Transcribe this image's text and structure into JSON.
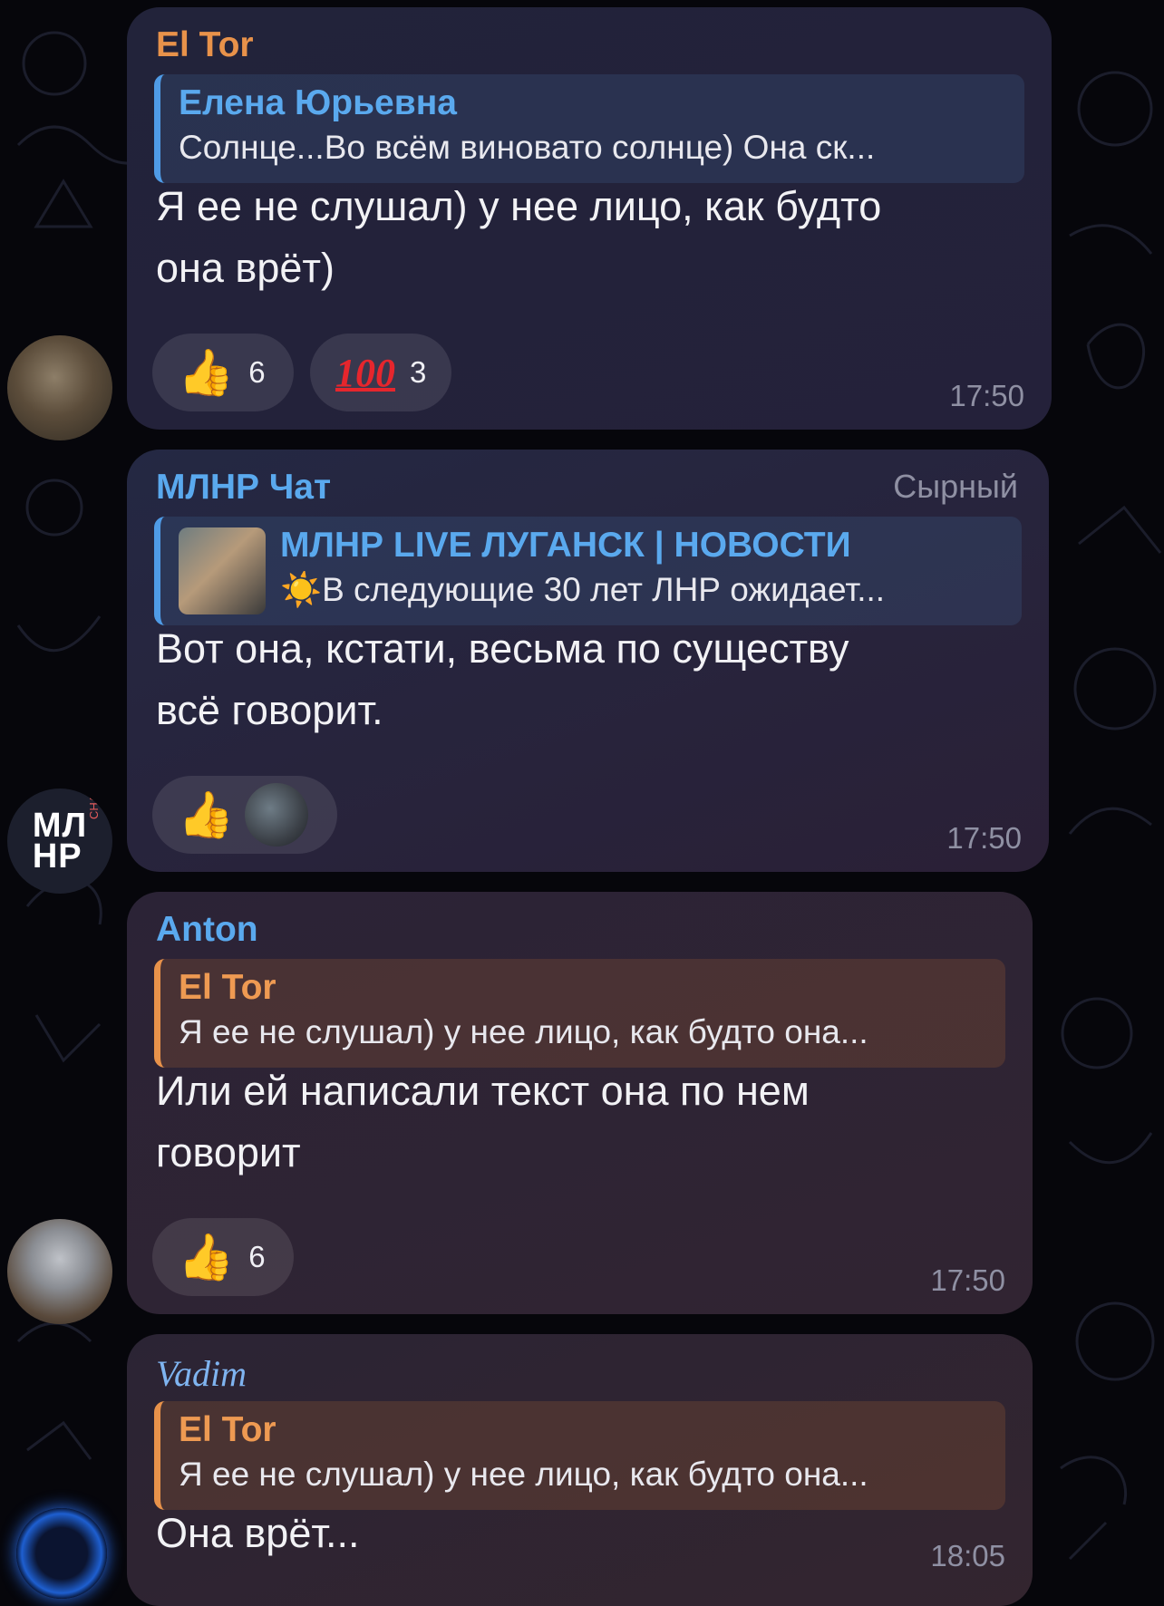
{
  "messages": [
    {
      "sender": "El Tor",
      "reply": {
        "name": "Елена Юрьевна",
        "text": "Солнце...Во всём виновато солнце) Она ск..."
      },
      "text_line1": "Я ее не слушал) у нее лицо, как будто",
      "text_line2": "она врёт)",
      "reactions": [
        {
          "emoji": "👍",
          "count": "6"
        },
        {
          "emoji": "100",
          "count": "3"
        }
      ],
      "time": "17:50",
      "avatar": "soldier-avatar"
    },
    {
      "sender": "МЛНР Чат",
      "role": "Сырный",
      "reply": {
        "name": "МЛНР LIVE ЛУГАНСК | НОВОСТИ",
        "text": "☀️В следующие 30 лет ЛНР ожидает..."
      },
      "text_line1": "Вот она, кстати, весьма по существу",
      "text_line2": "всё говорит.",
      "reactions": [
        {
          "emoji": "👍"
        }
      ],
      "time": "17:50",
      "avatar": {
        "line1": "МЛ",
        "line2": "НР",
        "tag": "CHAT"
      }
    },
    {
      "sender": "Anton",
      "reply": {
        "name": "El Tor",
        "text": "Я ее не слушал) у нее лицо, как будто она..."
      },
      "text_line1": "Или ей написали текст она по нем",
      "text_line2": "говорит",
      "reactions": [
        {
          "emoji": "👍",
          "count": "6"
        }
      ],
      "time": "17:50",
      "avatar": "kitten-avatar"
    },
    {
      "sender": "Vadim",
      "reply": {
        "name": "El Tor",
        "text": "Я ее не слушал) у нее лицо, как будто она..."
      },
      "text_line1": "Она врёт...",
      "time": "18:05",
      "avatar": "hacker-avatar"
    }
  ],
  "colors": {
    "background": "#06060b",
    "orange_name": "#e8924a",
    "blue_name": "#5aa9ee",
    "hundred_red": "#e6262d"
  }
}
